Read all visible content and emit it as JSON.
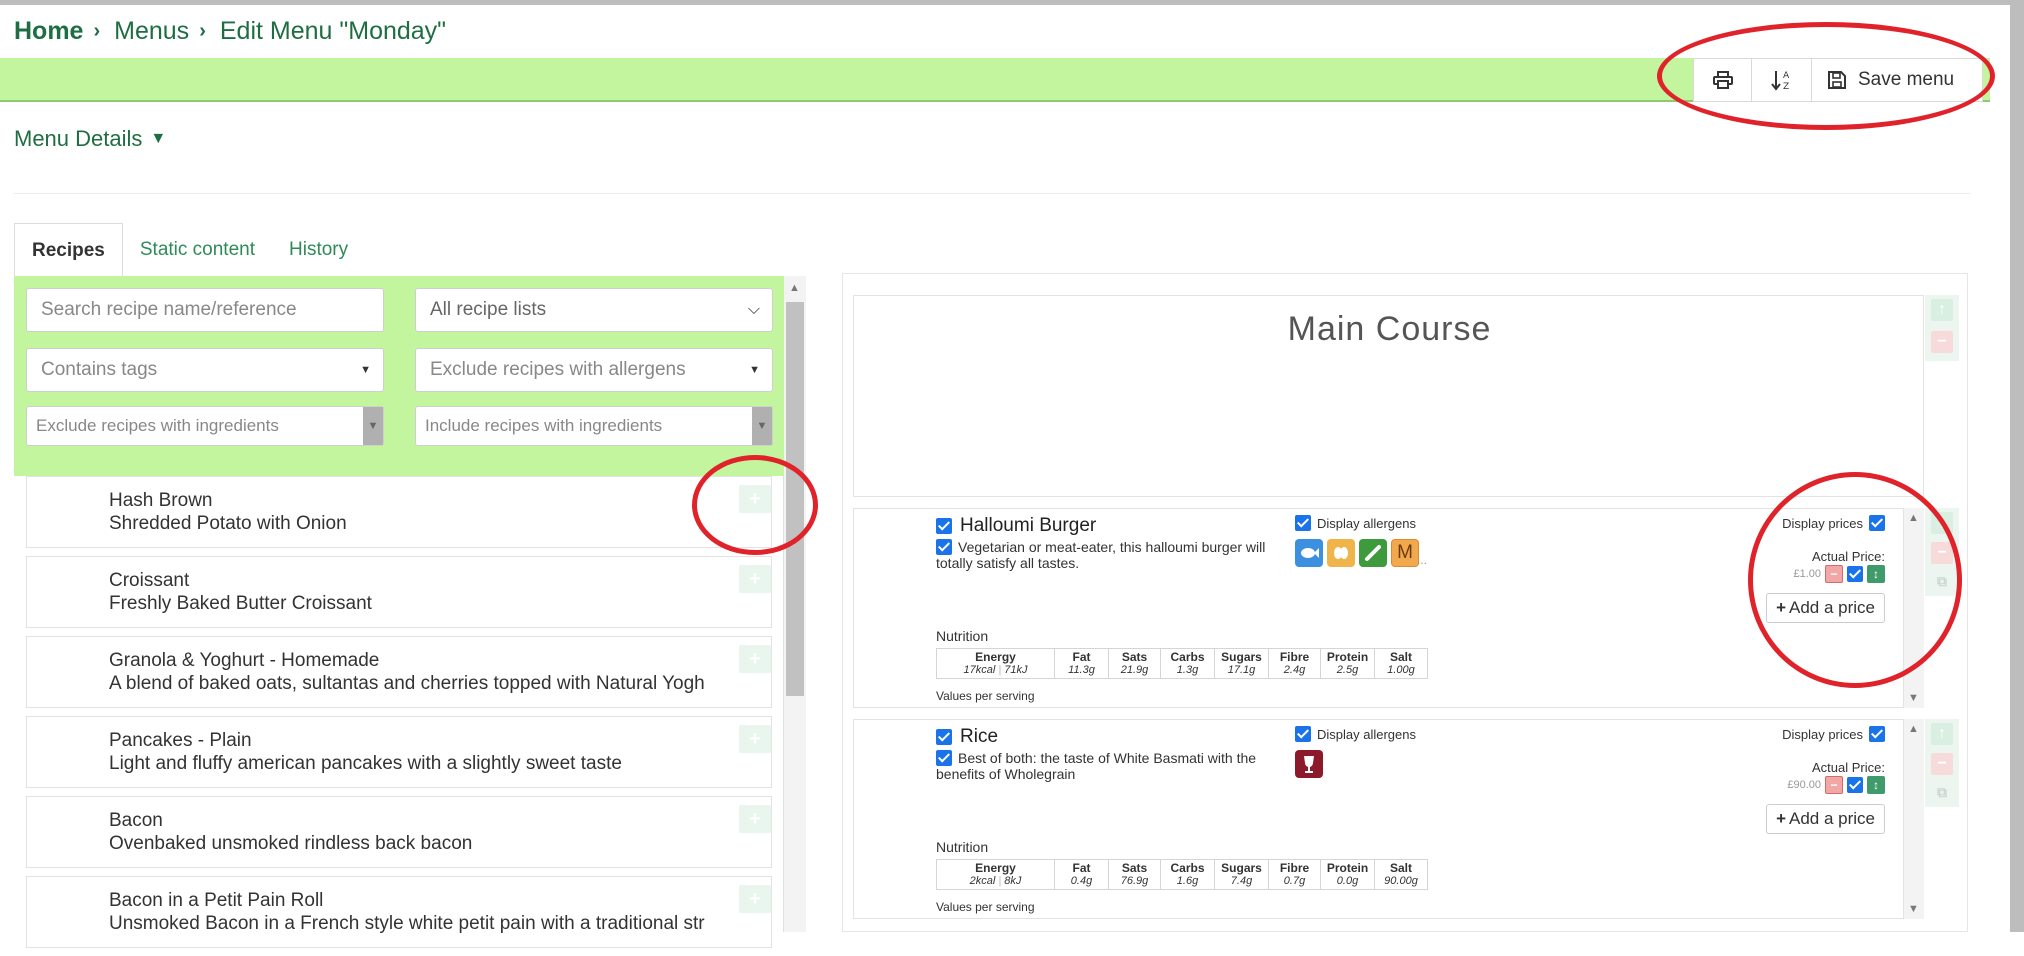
{
  "breadcrumb": {
    "home": "Home",
    "menus": "Menus",
    "current": "Edit Menu \"Monday\""
  },
  "toolbar": {
    "print_icon": "print-icon",
    "sort_icon": "sort-alpha-icon",
    "save_label": "Save menu"
  },
  "menu_details": {
    "label": "Menu Details"
  },
  "tabs": [
    {
      "label": "Recipes",
      "active": true
    },
    {
      "label": "Static content",
      "active": false
    },
    {
      "label": "History",
      "active": false
    }
  ],
  "filters": {
    "search_placeholder": "Search recipe name/reference",
    "recipe_lists": "All recipe lists",
    "contains_tags": "Contains tags",
    "exclude_allergens": "Exclude recipes with allergens",
    "exclude_ingredients": "Exclude recipes with ingredients",
    "include_ingredients": "Include recipes with ingredients"
  },
  "recipes": [
    {
      "name": "Hash Brown",
      "desc": "Shredded Potato with Onion"
    },
    {
      "name": "Croissant",
      "desc": "Freshly Baked Butter Croissant"
    },
    {
      "name": "Granola & Yoghurt - Homemade",
      "desc": "A blend of baked oats, sultantas and cherries topped with Natural Yogh"
    },
    {
      "name": "Pancakes - Plain",
      "desc": "Light and fluffy american pancakes with a slightly sweet taste"
    },
    {
      "name": "Bacon",
      "desc": "Ovenbaked unsmoked rindless back bacon"
    },
    {
      "name": "Bacon in a Petit Pain Roll",
      "desc": "Unsmoked Bacon in a French style white petit pain with a traditional str"
    }
  ],
  "section": {
    "title": "Main Course"
  },
  "labels": {
    "display_allergens": "Display allergens",
    "display_prices": "Display prices",
    "actual_price": "Actual Price:",
    "add_price": "Add a price",
    "nutrition": "Nutrition",
    "values_per_serving": "Values per serving"
  },
  "nutrition_headers": [
    "Energy",
    "Fat",
    "Sats",
    "Carbs",
    "Sugars",
    "Fibre",
    "Protein",
    "Salt"
  ],
  "items": [
    {
      "name": "Halloumi Burger",
      "desc": "Vegetarian or meat-eater, this halloumi burger will totally satisfy all tastes.",
      "price": "£1.00",
      "allergen_icons": [
        "fish-allergen-icon",
        "cereals-allergen-icon",
        "celery-allergen-icon",
        "mustard-allergen-icon"
      ],
      "allergen_letter": "M",
      "allergen_more": "...",
      "energy_kcal": "17kcal",
      "energy_kj": "71kJ",
      "fat": "11.3g",
      "sats": "21.9g",
      "carbs": "1.3g",
      "sugars": "17.1g",
      "fibre": "2.4g",
      "protein": "2.5g",
      "salt": "1.00g"
    },
    {
      "name": "Rice",
      "desc": "Best of both: the taste of White Basmati with the benefits of Wholegrain",
      "price": "£90.00",
      "allergen_icons": [
        "sulphites-allergen-icon"
      ],
      "energy_kcal": "2kcal",
      "energy_kj": "8kJ",
      "fat": "0.4g",
      "sats": "76.9g",
      "carbs": "1.6g",
      "sugars": "7.4g",
      "fibre": "0.7g",
      "protein": "0.0g",
      "salt": "90.00g"
    }
  ],
  "colors": {
    "brand_green": "#1f6e43",
    "toolbar_green": "#c3f59f",
    "checkbox_blue": "#1a73e8",
    "annotation_red": "#e0222a"
  }
}
